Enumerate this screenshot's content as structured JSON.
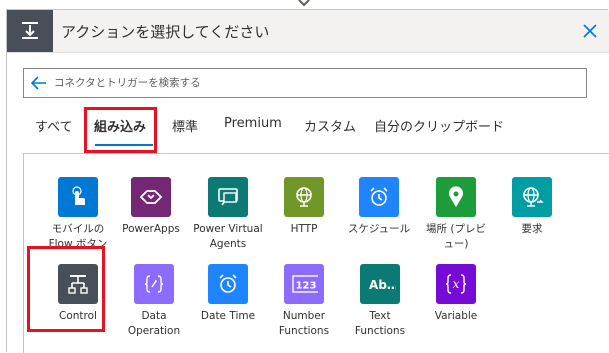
{
  "header": {
    "title": "アクションを選択してください",
    "icon": "action-icon",
    "close_icon": "close-icon"
  },
  "search": {
    "placeholder": "コネクタとトリガーを検索する",
    "back_icon": "back-arrow-icon"
  },
  "tabs": [
    {
      "label": "すべて"
    },
    {
      "label": "組み込み",
      "active": true
    },
    {
      "label": "標準"
    },
    {
      "label": "Premium"
    },
    {
      "label": "カスタム"
    },
    {
      "label": "自分のクリップボード"
    }
  ],
  "tiles": [
    {
      "label_line1": "モバイルの",
      "label_line2": "Flow ボタン",
      "color": "#0078d4",
      "icon": "touch-icon"
    },
    {
      "label_line1": "PowerApps",
      "label_line2": "",
      "color": "#742774",
      "icon": "powerapps-icon"
    },
    {
      "label_line1": "Power Virtual",
      "label_line2": "Agents",
      "color": "#0b7a75",
      "icon": "chat-bot-icon"
    },
    {
      "label_line1": "HTTP",
      "label_line2": "",
      "color": "#709727",
      "icon": "globe-icon"
    },
    {
      "label_line1": "スケジュール",
      "label_line2": "",
      "color": "#1f85ff",
      "icon": "alarm-clock-icon"
    },
    {
      "label_line1": "場所 (プレビ",
      "label_line2": "ュー)",
      "color": "#1e9e3b",
      "icon": "location-pin-icon"
    },
    {
      "label_line1": "要求",
      "label_line2": "",
      "color": "#009da5",
      "icon": "request-globe-icon"
    },
    {
      "label_line1": "Control",
      "label_line2": "",
      "color": "#484f58",
      "icon": "control-icon"
    },
    {
      "label_line1": "Data",
      "label_line2": "Operation",
      "color": "#8c6cff",
      "icon": "data-operation-icon"
    },
    {
      "label_line1": "Date Time",
      "label_line2": "",
      "color": "#1f85ff",
      "icon": "alarm-clock-icon"
    },
    {
      "label_line1": "Number",
      "label_line2": "Functions",
      "color": "#8c6cff",
      "icon": "number-123-icon"
    },
    {
      "label_line1": "Text",
      "label_line2": "Functions",
      "color": "#0b7a75",
      "icon": "text-ab-icon"
    },
    {
      "label_line1": "Variable",
      "label_line2": "",
      "color": "#770bd6",
      "icon": "variable-x-icon"
    }
  ]
}
